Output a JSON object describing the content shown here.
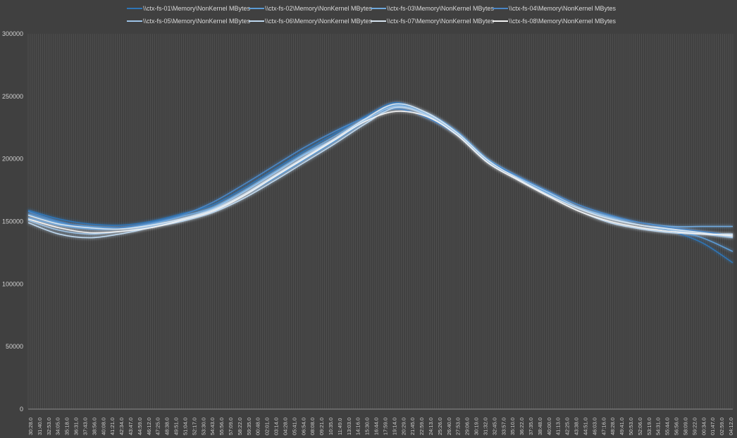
{
  "chart_data": {
    "type": "line",
    "title": "",
    "xlabel": "",
    "ylabel": "",
    "ylim": [
      0,
      300000
    ],
    "y_ticks": [
      0,
      50000,
      100000,
      150000,
      200000,
      250000,
      300000
    ],
    "grid": "vertical",
    "legend_position": "top",
    "x_tick_labels": [
      "30:28.0",
      "31:40.0",
      "32:53.0",
      "34:05.0",
      "35:18.0",
      "36:31.0",
      "37:43.0",
      "38:56.0",
      "40:08.0",
      "41:21.0",
      "42:34.0",
      "43:47.0",
      "44:59.0",
      "46:12.0",
      "47:25.0",
      "48:38.0",
      "49:51.0",
      "51:04.0",
      "52:17.0",
      "53:30.0",
      "54:43.0",
      "55:56.0",
      "57:09.0",
      "58:22.0",
      "59:35.0",
      "00:48.0",
      "02:01.0",
      "03:14.0",
      "04:28.0",
      "05:41.0",
      "06:54.0",
      "08:08.0",
      "09:21.0",
      "10:35.0",
      "11:49.0",
      "13:03.0",
      "14:16.0",
      "15:30.0",
      "16:44.0",
      "17:59.0",
      "19:14.0",
      "20:29.0",
      "21:45.0",
      "22:59.0",
      "24:13.0",
      "25:26.0",
      "26:40.0",
      "27:53.0",
      "29:06.0",
      "30:19.0",
      "31:32.0",
      "32:45.0",
      "33:57.0",
      "35:10.0",
      "36:22.0",
      "37:35.0",
      "38:48.0",
      "40:00.0",
      "41:13.0",
      "42:25.0",
      "43:38.0",
      "44:51.0",
      "46:03.0",
      "47:16.0",
      "48:28.0",
      "49:41.0",
      "50:53.0",
      "52:06.0",
      "53:19.0",
      "54:31.0",
      "55:44.0",
      "56:56.0",
      "58:09.0",
      "59:22.0",
      "00:34.0",
      "01:47.0",
      "02:59.0",
      "04:12.0"
    ],
    "series": [
      {
        "name": "\\\\ctx-fs-01\\Memory\\NonKernel MBytes",
        "color": "#2e75b6",
        "values": [
          159000,
          152000,
          148000,
          147000,
          150000,
          156000,
          163000,
          176000,
          191000,
          206000,
          220000,
          234000,
          245000,
          236000,
          222000,
          199000,
          185000,
          172000,
          160000,
          153000,
          147000,
          142000,
          133000,
          117000
        ]
      },
      {
        "name": "\\\\ctx-fs-02\\Memory\\NonKernel MBytes",
        "color": "#5b9bd5",
        "values": [
          156000,
          149000,
          146000,
          145000,
          147000,
          152000,
          158000,
          170000,
          184000,
          199000,
          214000,
          230000,
          243000,
          237000,
          222000,
          200000,
          186000,
          173000,
          161000,
          153000,
          147000,
          143000,
          137000,
          126000
        ]
      },
      {
        "name": "\\\\ctx-fs-03\\Memory\\NonKernel MBytes",
        "color": "#6fa8dc",
        "values": [
          153000,
          147000,
          144000,
          144000,
          148000,
          154000,
          161000,
          174000,
          189000,
          204000,
          218000,
          232000,
          243000,
          235000,
          221000,
          198000,
          185000,
          172000,
          161000,
          154000,
          149000,
          146000,
          146000,
          146000
        ]
      },
      {
        "name": "\\\\ctx-fs-04\\Memory\\NonKernel MBytes",
        "color": "#4a86c5",
        "values": [
          158000,
          150000,
          145000,
          145000,
          149000,
          155000,
          165000,
          179000,
          194000,
          209000,
          222000,
          233000,
          240000,
          233000,
          219000,
          199000,
          186000,
          174000,
          163000,
          155000,
          149000,
          145000,
          142000,
          139000
        ]
      },
      {
        "name": "\\\\ctx-fs-05\\Memory\\NonKernel MBytes",
        "color": "#9dc3e6",
        "values": [
          151000,
          143000,
          140000,
          142000,
          146000,
          152000,
          160000,
          173000,
          188000,
          203000,
          216000,
          231000,
          242000,
          236000,
          220000,
          198000,
          185000,
          173000,
          161000,
          153000,
          147000,
          143000,
          140000,
          137000
        ]
      },
      {
        "name": "\\\\ctx-fs-06\\Memory\\NonKernel MBytes",
        "color": "#bdd7ee",
        "values": [
          149000,
          140000,
          137000,
          140000,
          145000,
          150000,
          157000,
          168000,
          182000,
          197000,
          212000,
          228000,
          241000,
          235000,
          219000,
          197000,
          183000,
          170000,
          158000,
          149000,
          144000,
          141000,
          140000,
          140000
        ]
      },
      {
        "name": "\\\\ctx-fs-07\\Memory\\NonKernel MBytes",
        "color": "#d6e4f0",
        "values": [
          155000,
          148000,
          145000,
          144000,
          147000,
          152000,
          159000,
          171000,
          186000,
          201000,
          216000,
          232000,
          244000,
          237000,
          221000,
          199000,
          184000,
          171000,
          160000,
          152000,
          147000,
          144000,
          141000,
          138000
        ]
      },
      {
        "name": "\\\\ctx-fs-08\\Memory\\NonKernel MBytes",
        "color": "#f2f2f2",
        "values": [
          152000,
          145000,
          141000,
          142000,
          145000,
          151000,
          158000,
          170000,
          185000,
          200000,
          215000,
          230000,
          238000,
          234000,
          219000,
          197000,
          183000,
          170000,
          158000,
          150000,
          145000,
          142000,
          140000,
          139000
        ]
      }
    ]
  }
}
